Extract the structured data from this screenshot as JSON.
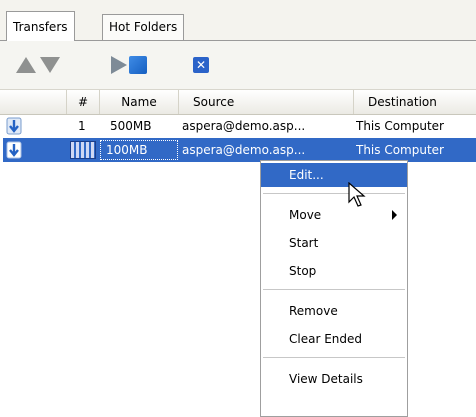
{
  "tabs": [
    {
      "label": "Transfers",
      "active": true
    },
    {
      "label": "Hot Folders",
      "active": false
    }
  ],
  "toolbar": {
    "icons": [
      "move-up-icon",
      "move-down-icon",
      "start-icon",
      "stop-icon",
      "remove-icon"
    ],
    "remove_glyph": "✕"
  },
  "columns": [
    "#",
    "Name",
    "Source",
    "Destination"
  ],
  "rows": [
    {
      "index": "1",
      "name": "500MB",
      "source": "aspera@demo.asp...",
      "destination": "This Computer"
    },
    {
      "index": "",
      "name": "100MB",
      "source": "aspera@demo.asp...",
      "destination": "This Computer",
      "selected": true
    }
  ],
  "context_menu": {
    "items": [
      {
        "label": "Edit...",
        "highlighted": true
      },
      {
        "label": "Move",
        "submenu": true
      },
      {
        "label": "Start"
      },
      {
        "label": "Stop"
      },
      {
        "label": "Remove"
      },
      {
        "label": "Clear Ended"
      },
      {
        "label": "View Details"
      }
    ]
  },
  "colors": {
    "selection": "#3169c6",
    "toolbar_bg": "#f5f5f1",
    "tab_bar_bg": "#f4f3ee"
  }
}
